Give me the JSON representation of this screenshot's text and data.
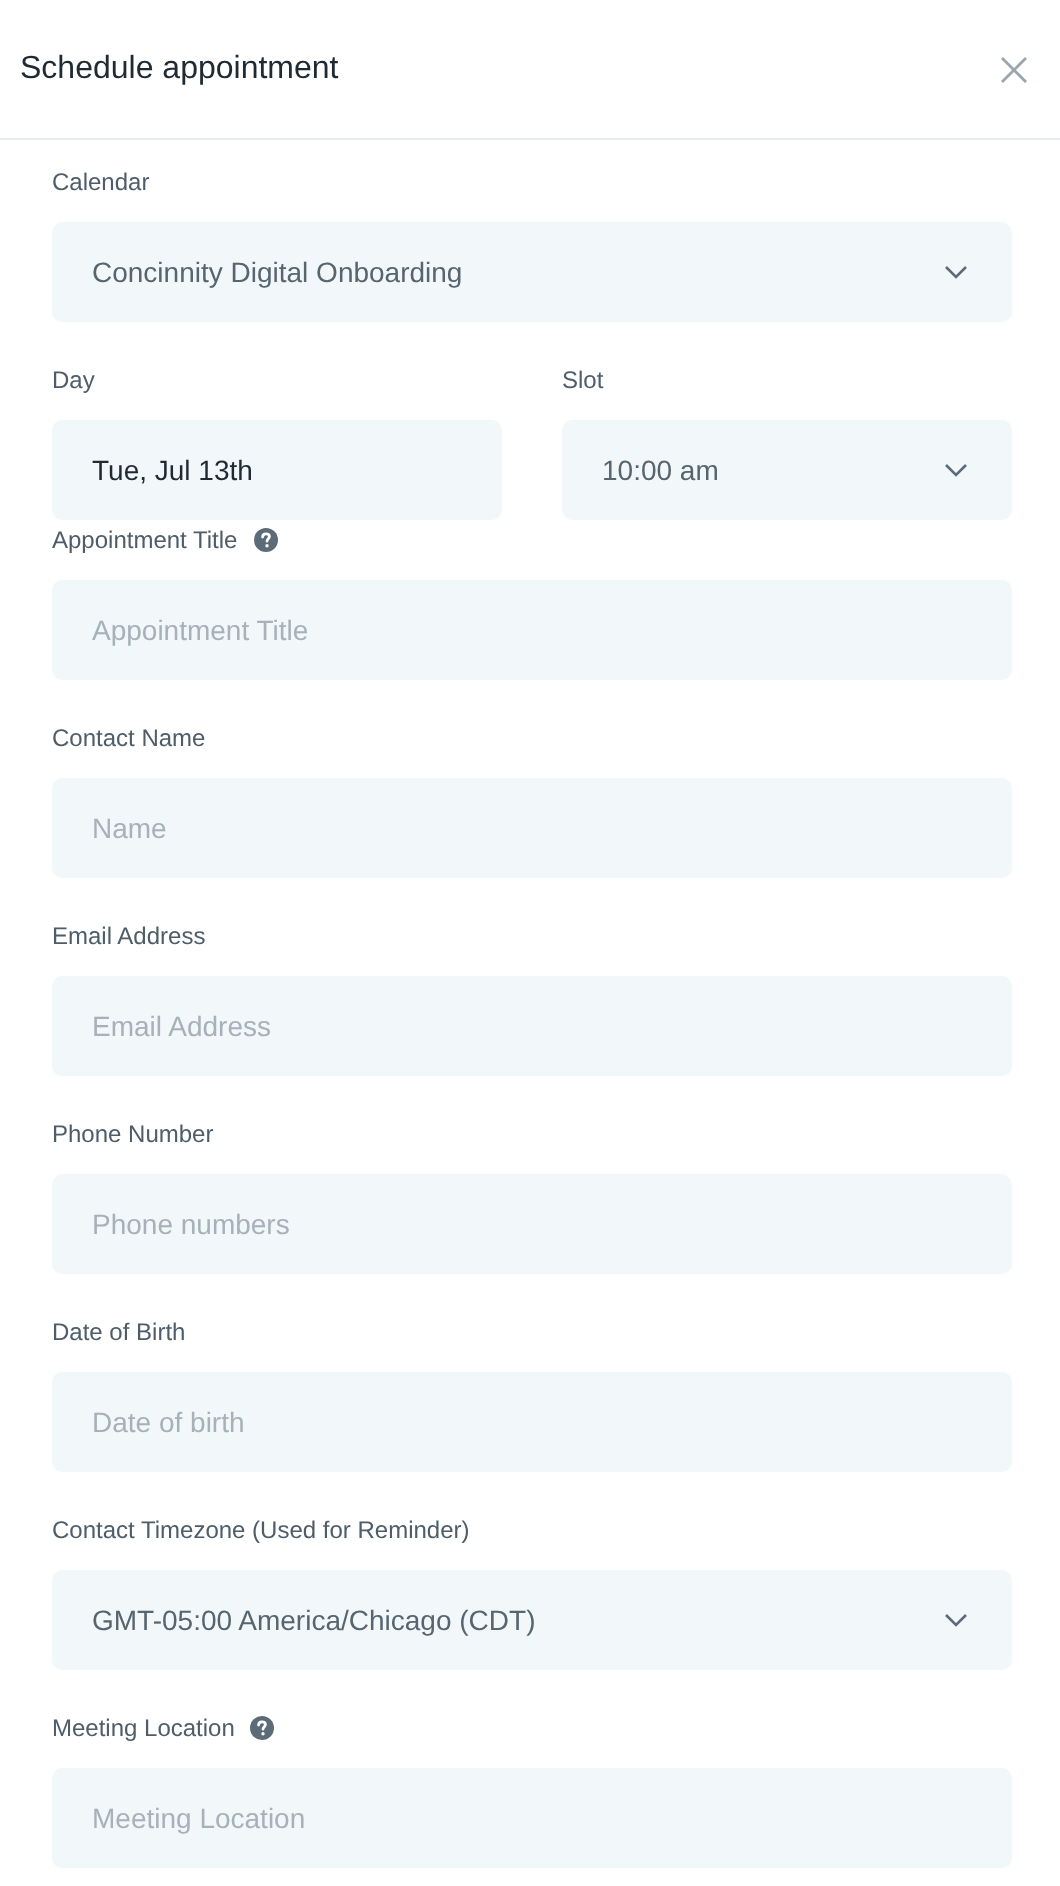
{
  "dialog": {
    "title": "Schedule appointment"
  },
  "fields": [
    {
      "kind": "select",
      "label": "Calendar",
      "value": "Concinnity Digital Onboarding"
    },
    {
      "kind": "row",
      "items": [
        {
          "kind": "input",
          "label": "Day",
          "value": "Tue, Jul 13th"
        },
        {
          "kind": "select",
          "label": "Slot",
          "value": "10:00 am"
        }
      ]
    },
    {
      "kind": "input",
      "label": "Appointment Title",
      "help": true,
      "placeholder": "Appointment Title"
    },
    {
      "kind": "input",
      "label": "Contact Name",
      "placeholder": "Name"
    },
    {
      "kind": "input",
      "label": "Email Address",
      "placeholder": "Email Address"
    },
    {
      "kind": "input",
      "label": "Phone Number",
      "placeholder": "Phone numbers"
    },
    {
      "kind": "input",
      "label": "Date of Birth",
      "placeholder": "Date of birth"
    },
    {
      "kind": "select",
      "label": "Contact Timezone (Used for Reminder)",
      "value": "GMT-05:00 America/Chicago (CDT)"
    },
    {
      "kind": "input",
      "label": "Meeting Location",
      "help": true,
      "placeholder": "Meeting Location"
    }
  ]
}
